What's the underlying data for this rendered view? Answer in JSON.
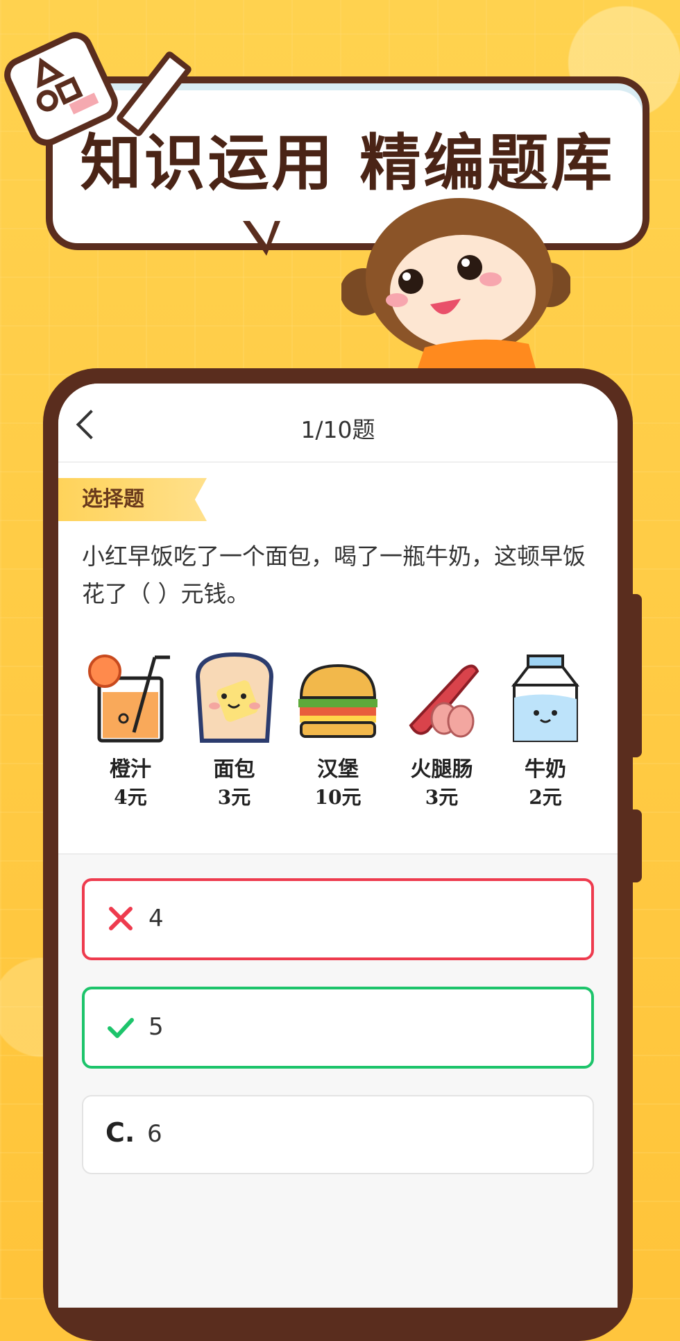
{
  "banner": {
    "headline": "知识运用 精编题库"
  },
  "screen": {
    "title": "1/10题",
    "question_type": "选择题",
    "question_text": "小红早饭吃了一个面包，喝了一瓶牛奶，这顿早饭花了（ ）元钱。",
    "foods": [
      {
        "name": "橙汁",
        "price": "4元",
        "icon": "orange-juice-icon"
      },
      {
        "name": "面包",
        "price": "3元",
        "icon": "bread-icon"
      },
      {
        "name": "汉堡",
        "price": "10元",
        "icon": "hamburger-icon"
      },
      {
        "name": "火腿肠",
        "price": "3元",
        "icon": "sausage-icon"
      },
      {
        "name": "牛奶",
        "price": "2元",
        "icon": "milk-icon"
      }
    ],
    "options": [
      {
        "status": "wrong",
        "value": "4"
      },
      {
        "status": "correct",
        "value": "5"
      },
      {
        "letter": "C.",
        "value": "6"
      }
    ]
  },
  "colors": {
    "background": "#FFC53D",
    "frame": "#5A2D1E",
    "wrong": "#EE3B4E",
    "correct": "#1DC46B"
  }
}
